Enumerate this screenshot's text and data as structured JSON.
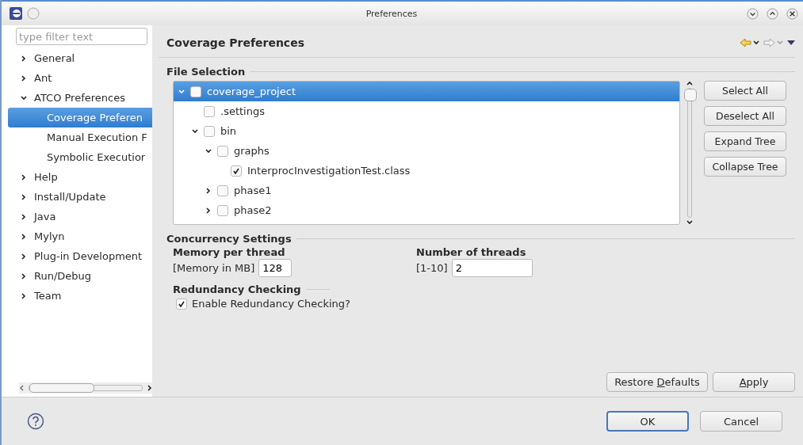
{
  "window": {
    "title": "Preferences"
  },
  "sidebar": {
    "filter": {
      "placeholder": "type filter text"
    },
    "items": [
      {
        "label": "General",
        "expanded": false,
        "selected": false
      },
      {
        "label": "Ant",
        "expanded": false,
        "selected": false
      },
      {
        "label": "ATCO Preferences",
        "expanded": true,
        "selected": false,
        "children": [
          {
            "label": "Coverage Preferen",
            "selected": true
          },
          {
            "label": "Manual Execution F",
            "selected": false
          },
          {
            "label": "Symbolic Executior",
            "selected": false
          }
        ]
      },
      {
        "label": "Help",
        "expanded": false,
        "selected": false
      },
      {
        "label": "Install/Update",
        "expanded": false,
        "selected": false
      },
      {
        "label": "Java",
        "expanded": false,
        "selected": false
      },
      {
        "label": "Mylyn",
        "expanded": false,
        "selected": false
      },
      {
        "label": "Plug-in Development",
        "expanded": false,
        "selected": false
      },
      {
        "label": "Run/Debug",
        "expanded": false,
        "selected": false
      },
      {
        "label": "Team",
        "expanded": false,
        "selected": false
      }
    ]
  },
  "page": {
    "title": "Coverage Preferences",
    "file_selection": {
      "title": "File Selection",
      "tree": [
        {
          "label": "coverage_project",
          "expanded": true,
          "checked": false,
          "selected": true,
          "children": [
            {
              "label": ".settings",
              "checked": false,
              "selected": false
            },
            {
              "label": "bin",
              "expanded": true,
              "checked": false,
              "selected": false,
              "children": [
                {
                  "label": "graphs",
                  "expanded": true,
                  "checked": false,
                  "selected": false,
                  "children": [
                    {
                      "label": "InterprocInvestigationTest.class",
                      "checked": true,
                      "selected": false
                    }
                  ]
                },
                {
                  "label": "phase1",
                  "expanded": false,
                  "checked": false,
                  "selected": false
                },
                {
                  "label": "phase2",
                  "expanded": false,
                  "checked": false,
                  "selected": false
                }
              ]
            }
          ]
        }
      ],
      "buttons": [
        "Select All",
        "Deselect All",
        "Expand Tree",
        "Collapse Tree"
      ]
    },
    "concurrency": {
      "title": "Concurrency Settings",
      "memory": {
        "title": "Memory per thread",
        "label": "[Memory in MB]",
        "value": "128"
      },
      "threads": {
        "title": "Number of threads",
        "label": "[1-10]",
        "value": "2"
      }
    },
    "redundancy": {
      "title": "Redundancy Checking",
      "option": {
        "label": "Enable Redundancy Checking?",
        "checked": true
      }
    },
    "buttons": [
      {
        "before": "Restore ",
        "mnemonic": "D",
        "after": "efaults"
      },
      {
        "mnemonic": "A",
        "after": "pply"
      }
    ]
  },
  "footer": {
    "buttons": [
      {
        "label": "OK",
        "default": true
      },
      {
        "label": "Cancel",
        "default": false
      }
    ]
  }
}
